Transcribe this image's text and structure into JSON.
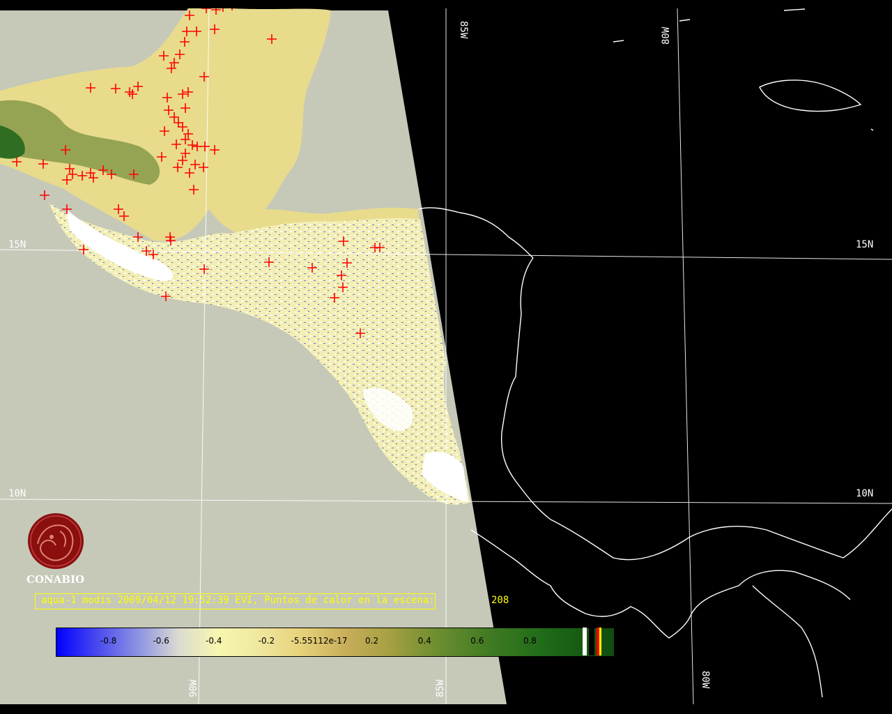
{
  "map": {
    "grid_labels": {
      "lat_left_15": "15N",
      "lat_right_15": "15N",
      "lat_left_10": "10N",
      "lat_right_10": "10N",
      "lon_top_85": "85W",
      "lon_top_80": "80W",
      "lon_bottom_90": "90W",
      "lon_bottom_85": "85W",
      "lon_bottom_80": "80W"
    },
    "colors": {
      "no_data_swath": "#c6c9b8",
      "background": "#000000",
      "coastline": "#ffffff",
      "grid": "#ffffff",
      "hotspot": "#ff0000"
    },
    "hotspot_marker": "red-plus",
    "hotspot_count": 208
  },
  "logo": {
    "text": "CONABIO",
    "color": "#8b0f0f"
  },
  "caption": {
    "text": "aqua-1 modis 2009/04/12 19:52:39 EVI, Puntos de calor en la escena:",
    "count": "208",
    "color": "#ffff00"
  },
  "colorbar": {
    "ticks": [
      "-0.8",
      "-0.6",
      "-0.4",
      "-0.2",
      "-5.55112e-17",
      "0.2",
      "0.4",
      "0.6",
      "0.8"
    ],
    "tick_values": [
      -0.8,
      -0.6,
      -0.4,
      -0.2,
      0.0,
      0.2,
      0.4,
      0.6,
      0.8
    ],
    "range": [
      -1.0,
      1.0
    ],
    "extra_classes": [
      {
        "name": "no-data",
        "color": "#ffffff"
      },
      {
        "name": "cloud",
        "color": "#000000"
      },
      {
        "name": "hotspot",
        "color": "#ff0000"
      },
      {
        "name": "other",
        "color": "#ffff00"
      }
    ]
  }
}
